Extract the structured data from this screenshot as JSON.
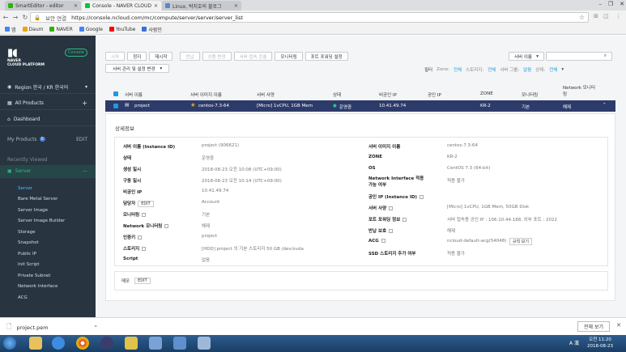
{
  "browser": {
    "tabs": [
      {
        "title": "SmartEditor - editor",
        "color": "#2db400",
        "active": false
      },
      {
        "title": "Console - NAVER CLOUD",
        "color": "#00c73c",
        "active": true
      },
      {
        "title": "Linux, 박지호의 블로그",
        "color": "#5f86c8",
        "active": false
      }
    ],
    "security_label": "보안 연결",
    "url": "https://console.ncloud.com/mc/compute/server/server/server_list",
    "bookmarks": [
      {
        "label": "앱",
        "color": "#4285f4"
      },
      {
        "label": "Daum",
        "color": "#f0a30a"
      },
      {
        "label": "NAVER",
        "color": "#2db400"
      },
      {
        "label": "Google",
        "color": "#4285f4"
      },
      {
        "label": "YouTube",
        "color": "#ff0000"
      },
      {
        "label": "사람인",
        "color": "#3a6fd8"
      }
    ]
  },
  "sidebar": {
    "logo_lines": [
      "NAVER",
      "CLOUD PLATFORM"
    ],
    "console_badge": "Console",
    "region": "Region 한국 / KR 한국어",
    "all_products": "All Products",
    "dashboard": "Dashboard",
    "my_products": "My Products",
    "my_products_count": "0",
    "edit": "EDIT",
    "recently_viewed": "Recently Viewed",
    "server_section": "Server",
    "items": [
      "Server",
      "Bare Metal Server",
      "Server Image",
      "Server Image Builder",
      "Storage",
      "Snapshot",
      "Public IP",
      "Init Script",
      "Private Subnet",
      "Network Interface",
      "ACG"
    ]
  },
  "toolbar": {
    "buttons": [
      {
        "label": "시작",
        "disabled": true
      },
      {
        "label": "정지",
        "disabled": false
      },
      {
        "label": "재시작",
        "disabled": false
      },
      {
        "label": "반납",
        "disabled": true
      },
      {
        "label": "상품 변경",
        "disabled": true
      },
      {
        "label": "서버 접속 콘솔",
        "disabled": true
      },
      {
        "label": "모니터링",
        "disabled": false
      },
      {
        "label": "포트 포워딩 설정",
        "disabled": false
      }
    ],
    "manage_dropdown": "서버 관리 및 설정 변경",
    "search_select": "서버 이름",
    "search_placeholder": ""
  },
  "filter": {
    "label": "필터",
    "zone": "Zone:",
    "zone_val": "전체",
    "storage": "스토리지:",
    "storage_val": "전체",
    "svc_group": "서버 그룹:",
    "svc_group_val": "없음",
    "status": "상태:",
    "status_val": "전체"
  },
  "table": {
    "headers": [
      "서버 이름",
      "서버 이미지 이름",
      "서버 사양",
      "상태",
      "비공인 IP",
      "공인 IP",
      "ZONE",
      "모니터링",
      "Network 모니터링"
    ],
    "row": {
      "name": "project",
      "image": "centos-7.3-64",
      "spec": "[Micro] 1vCPU, 1GB Mem",
      "status": "운영중",
      "private_ip": "10.41.49.74",
      "public_ip": "",
      "zone": "KR-2",
      "monitoring": "기본",
      "net_monitoring": "해제"
    }
  },
  "detail": {
    "title": "상세정보",
    "left": [
      {
        "label": "서버 이름 (Instance ID)",
        "value": "project (906621)"
      },
      {
        "label": "상태",
        "value": "운영중"
      },
      {
        "label": "생성 일시",
        "value": "2018-08-23 오전 10:08 (UTC+09:00)"
      },
      {
        "label": "구동 일시",
        "value": "2018-08-23 오전 10:14 (UTC+09:00)"
      },
      {
        "label": "비공인 IP",
        "value": "10.41.49.74"
      },
      {
        "label": "담당자",
        "value": "Account"
      },
      {
        "label": "모니터링",
        "value": "기본"
      },
      {
        "label": "Network 모니터링",
        "value": "해제"
      },
      {
        "label": "인증키",
        "value": "project"
      },
      {
        "label": "스토리지",
        "value": "[HDD] project 의 기본 스토리지 50 GB /dev/xvda"
      },
      {
        "label": "Script",
        "value": "없음"
      }
    ],
    "right": [
      {
        "label": "서버 이미지 이름",
        "value": "centos-7.3-64"
      },
      {
        "label": "ZONE",
        "value": "KR-2"
      },
      {
        "label": "OS",
        "value": "CentOS 7.3 (64-bit)"
      },
      {
        "label": "Network Interface 적용 가능 여부",
        "value": "적용 불가"
      },
      {
        "label": "공인 IP (Instance ID)",
        "value": ""
      },
      {
        "label": "서버 사양",
        "value": "[Micro] 1vCPU, 1GB Mem, 50GB Disk"
      },
      {
        "label": "포트 포워딩 정보",
        "value": "서버 접속용 공인 IP : 106.10.44.188, 외부 포트 : 2022"
      },
      {
        "label": "반납 보호",
        "value": "해제"
      },
      {
        "label": "ACG",
        "value": "ncloud-default-acg(54048)"
      },
      {
        "label": "SSD 스토리지 추가 여부",
        "value": "적용 불가"
      }
    ],
    "edit_btn": "EDIT",
    "acg_btn": "규칙 보기",
    "memo_label": "메모",
    "memo_edit": "EDIT"
  },
  "download": {
    "file": "project.pem",
    "show_all": "전체 보기"
  },
  "taskbar": {
    "time": "오전 11:20",
    "date": "2018-08-23",
    "ime": "A 漢"
  }
}
